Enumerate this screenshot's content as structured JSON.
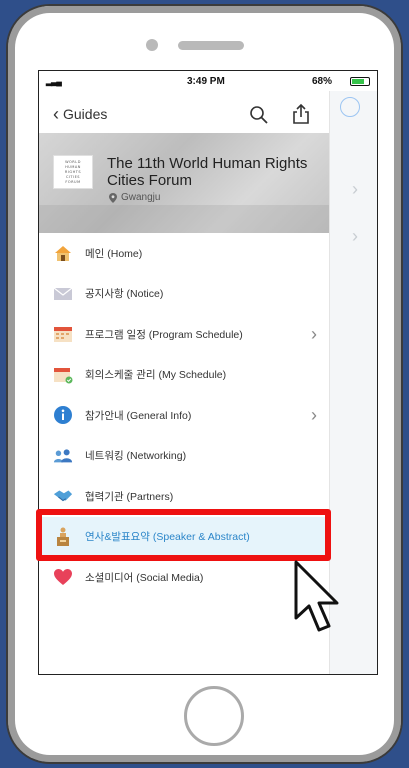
{
  "status_bar": {
    "time": "3:49 PM",
    "battery": "68%"
  },
  "nav": {
    "back_label": "Guides"
  },
  "event": {
    "logo_lines": [
      "WORLD",
      "HUMAN",
      "RIGHTS",
      "CITIES",
      "FORUM"
    ],
    "title": "The 11th World Human Rights Cities Forum",
    "location": "Gwangju"
  },
  "menu": {
    "items": [
      {
        "label": "메인 (Home)",
        "icon": "home-icon",
        "has_arrow": false
      },
      {
        "label": "공지사항 (Notice)",
        "icon": "envelope-icon",
        "has_arrow": false
      },
      {
        "label": "프로그램 일정 (Program Schedule)",
        "icon": "calendar-icon",
        "has_arrow": true
      },
      {
        "label": "회의스케줄 관리 (My Schedule)",
        "icon": "calendar-check-icon",
        "has_arrow": false
      },
      {
        "label": "참가안내 (General  Info)",
        "icon": "info-icon",
        "has_arrow": true
      },
      {
        "label": "네트워킹 (Networking)",
        "icon": "people-icon",
        "has_arrow": false
      },
      {
        "label": "협력기관 (Partners)",
        "icon": "handshake-icon",
        "has_arrow": false
      },
      {
        "label": "연사&발표요약 (Speaker & Abstract)",
        "icon": "podium-icon",
        "has_arrow": false,
        "active": true
      },
      {
        "label": "소셜미디어 (Social Media)",
        "icon": "heart-icon",
        "has_arrow": false
      }
    ]
  },
  "colors": {
    "highlight": "#ee1111",
    "accent": "#2c86c9",
    "active_bg": "#e6f4fb"
  }
}
